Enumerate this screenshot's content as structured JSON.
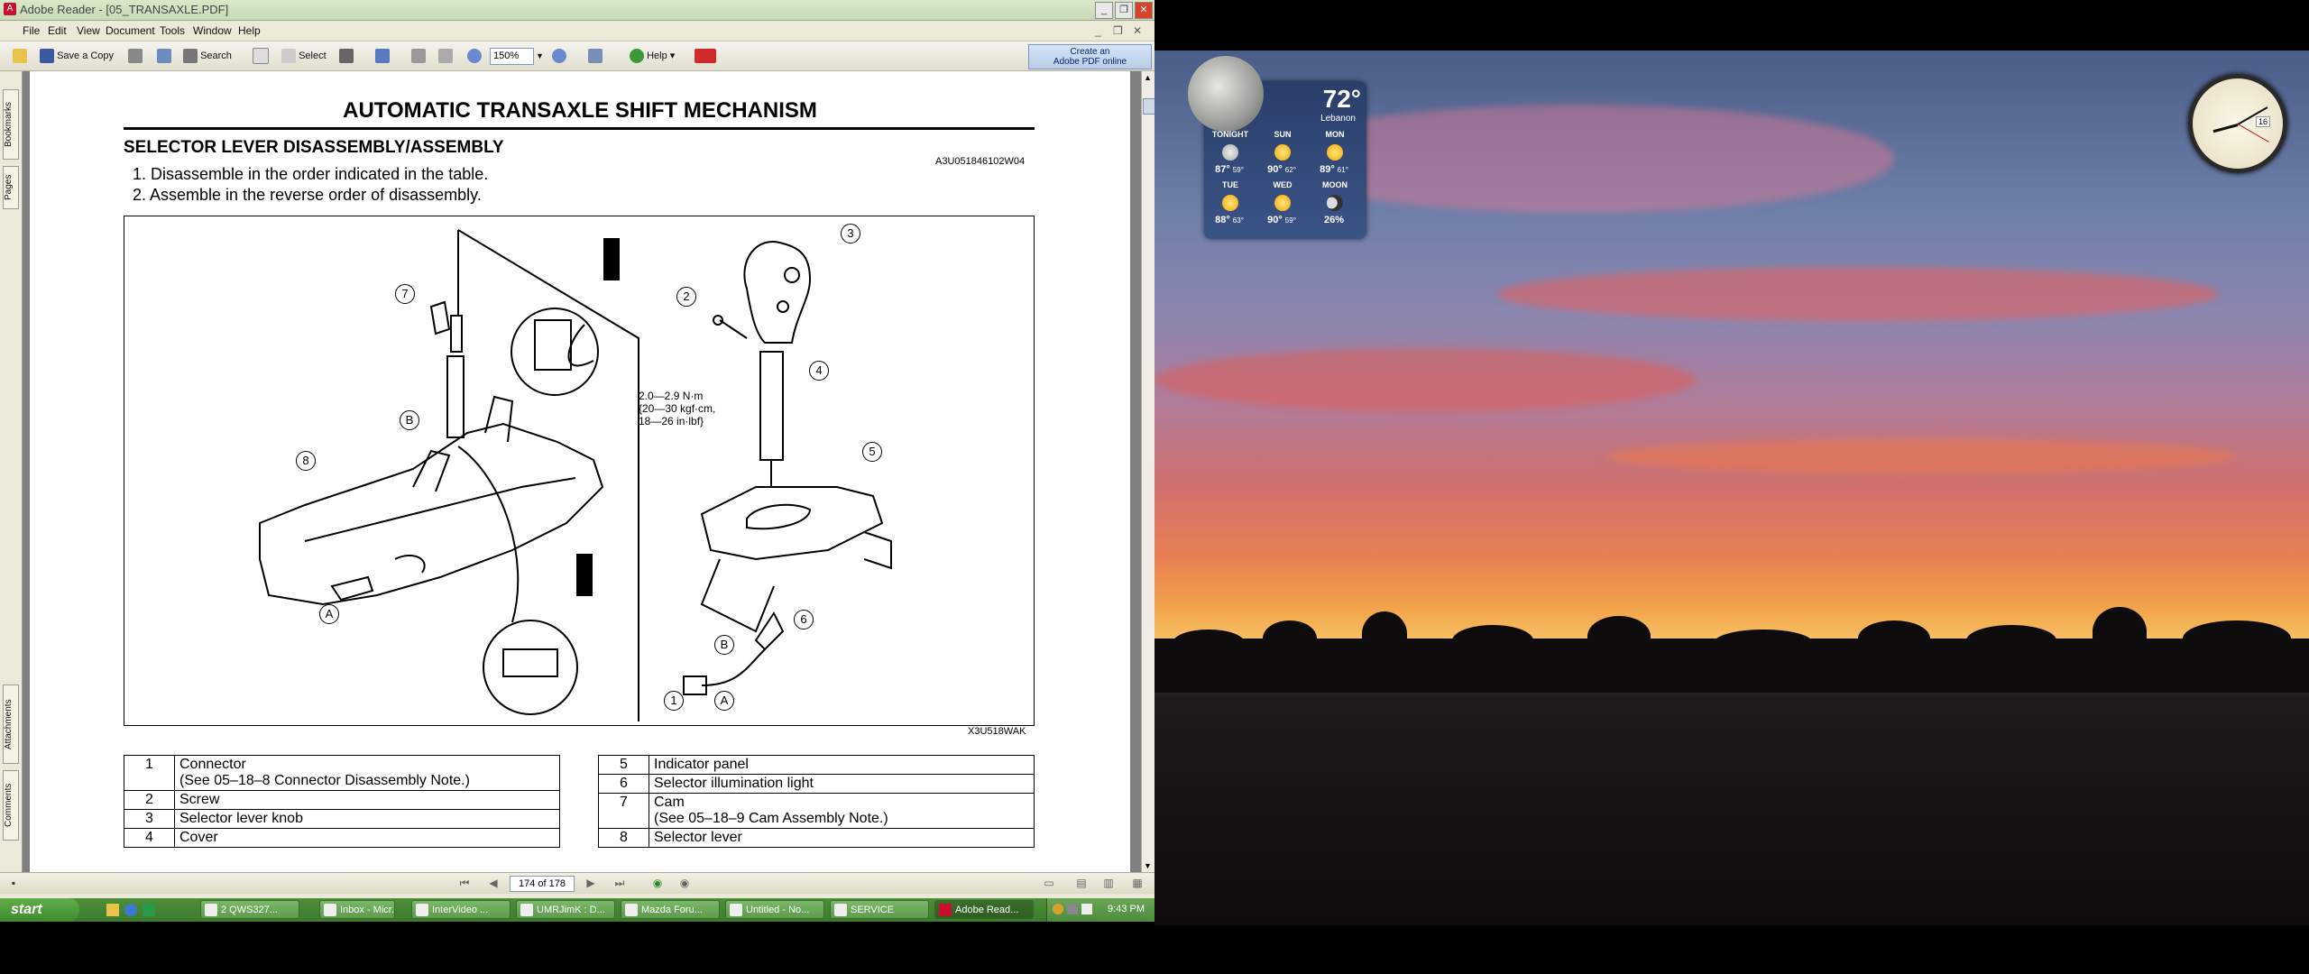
{
  "window": {
    "title": "Adobe Reader - [05_TRANSAXLE.PDF]"
  },
  "menu": [
    "File",
    "Edit",
    "View",
    "Document",
    "Tools",
    "Window",
    "Help"
  ],
  "toolbar": {
    "save_copy": "Save a Copy",
    "search": "Search",
    "select": "Select",
    "zoom": "150%",
    "help": "Help",
    "create_pdf": [
      "Create an",
      "Adobe PDF online"
    ]
  },
  "side_tabs": [
    "Bookmarks",
    "Pages",
    "Attachments",
    "Comments"
  ],
  "page": {
    "title": "AUTOMATIC TRANSAXLE SHIFT MECHANISM",
    "section": "SELECTOR LEVER DISASSEMBLY/ASSEMBLY",
    "code": "A3U051846102W04",
    "steps": [
      "1.  Disassemble in the order indicated in the table.",
      "2.  Assemble in the reverse order of disassembly."
    ],
    "figure_code": "X3U518WAK",
    "torque": [
      "2.0—2.9 N·m",
      "{20—30 kgf·cm,",
      "18—26 in·lbf}"
    ],
    "callouts": [
      "1",
      "2",
      "3",
      "4",
      "5",
      "6",
      "7",
      "8",
      "A",
      "B",
      "A",
      "B"
    ],
    "parts_left": [
      {
        "n": "1",
        "label": "Connector",
        "note": "(See 05–18–8 Connector Disassembly Note.)"
      },
      {
        "n": "2",
        "label": "Screw",
        "note": ""
      },
      {
        "n": "3",
        "label": "Selector lever knob",
        "note": ""
      },
      {
        "n": "4",
        "label": "Cover",
        "note": ""
      }
    ],
    "parts_right": [
      {
        "n": "5",
        "label": "Indicator panel",
        "note": ""
      },
      {
        "n": "6",
        "label": "Selector illumination light",
        "note": ""
      },
      {
        "n": "7",
        "label": "Cam",
        "note": "(See 05–18–9 Cam Assembly Note.)"
      },
      {
        "n": "8",
        "label": "Selector lever",
        "note": ""
      }
    ]
  },
  "nav": {
    "page_indicator": "174 of 178"
  },
  "taskbar": {
    "start": "start",
    "tasks": [
      "2 QWS327...",
      "Inbox - Micr...",
      "InterVideo ...",
      "UMRJimK : D...",
      "Mazda Foru...",
      "Untitled - No...",
      "SERVICE",
      "Adobe Read..."
    ],
    "time": "9:43 PM"
  },
  "weather": {
    "temp": "72°",
    "location": "Lebanon",
    "days": [
      {
        "day": "TONIGHT",
        "hi": "87°",
        "lo": "59°"
      },
      {
        "day": "SUN",
        "hi": "90°",
        "lo": "62°"
      },
      {
        "day": "MON",
        "hi": "89°",
        "lo": "61°"
      },
      {
        "day": "TUE",
        "hi": "88°",
        "lo": "63°"
      },
      {
        "day": "WED",
        "hi": "90°",
        "lo": "59°"
      },
      {
        "day": "MOON",
        "hi": "26%",
        "lo": ""
      }
    ]
  },
  "clock": {
    "date": "16"
  }
}
